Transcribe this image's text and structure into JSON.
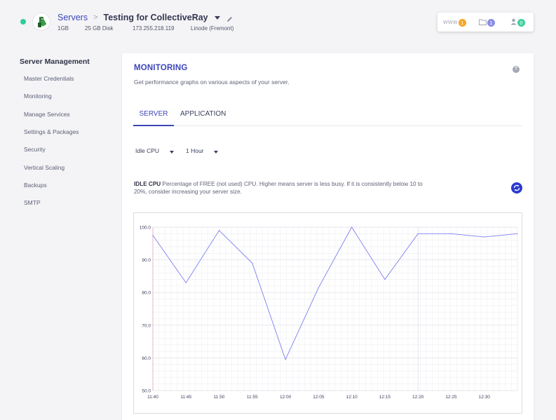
{
  "header": {
    "breadcrumb_root": "Servers",
    "breadcrumb_sep": ">",
    "server_name": "Testing for CollectiveRay",
    "meta": {
      "ram": "1GB",
      "disk": "25 GB Disk",
      "ip": "173.255.218.119",
      "provider": "Linode (Fremont)"
    },
    "badges": [
      {
        "label": "WWW",
        "count": "1",
        "color": "#f5a623"
      },
      {
        "label": "",
        "icon": "folder-icon",
        "count": "1",
        "color": "#8a8ee6"
      },
      {
        "label": "",
        "icon": "user-icon",
        "count": "0",
        "color": "#3fcf9b"
      }
    ],
    "status_color": "#2ecc9a"
  },
  "sidebar": {
    "title": "Server Management",
    "items": [
      {
        "label": "Master Credentials"
      },
      {
        "label": "Monitoring"
      },
      {
        "label": "Manage Services"
      },
      {
        "label": "Settings & Packages"
      },
      {
        "label": "Security"
      },
      {
        "label": "Vertical Scaling"
      },
      {
        "label": "Backups"
      },
      {
        "label": "SMTP"
      }
    ]
  },
  "main": {
    "title": "MONITORING",
    "subtitle": "Get performance graphs on various aspects of your server.",
    "help": "?",
    "tabs": [
      {
        "label": "SERVER",
        "active": true
      },
      {
        "label": "APPLICATION",
        "active": false
      }
    ],
    "metric_select": "Idle CPU",
    "range_select": "1 Hour",
    "desc_strong": "IDLE CPU",
    "desc_text": " Percentage of FREE (not used) CPU. Higher means server is less busy. If it is consistently below 10 to 20%, consider increasing your server size.",
    "accent": "#3c45b8"
  },
  "chart_data": {
    "type": "line",
    "title": "",
    "xlabel": "",
    "ylabel": "",
    "ylim": [
      50,
      100
    ],
    "yticks": [
      "100.0",
      "90.0",
      "80.0",
      "70.0",
      "60.0",
      "50.0"
    ],
    "xticks": [
      "11:40",
      "11:45",
      "11:50",
      "11:55",
      "12:00",
      "12:05",
      "12:10",
      "12:15",
      "12:20",
      "12:25",
      "12:30"
    ],
    "x": [
      "11:40",
      "11:45",
      "11:50",
      "11:55",
      "12:00",
      "12:05",
      "12:10",
      "12:15",
      "12:20",
      "12:25",
      "12:30",
      "12:35"
    ],
    "values": [
      97.5,
      83,
      99,
      89,
      59.5,
      81.5,
      100,
      84,
      98,
      98,
      97,
      98
    ],
    "line_color": "#7b7ff0",
    "grid": true
  }
}
